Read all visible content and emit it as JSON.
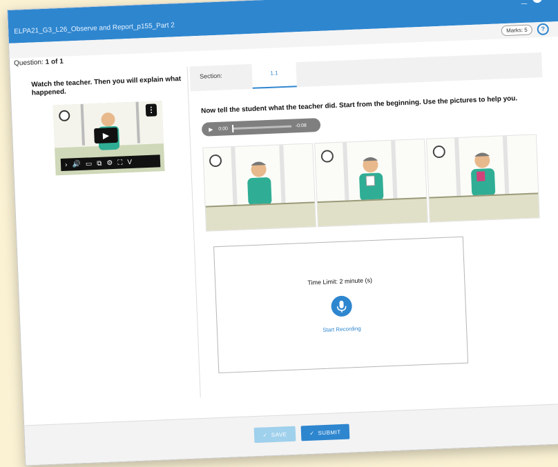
{
  "window": {
    "title": "ELPA21_G3_L26_Observe and Report_p155_Part 2",
    "minimize_symbol": "_",
    "close_symbol": "✕"
  },
  "marks": {
    "label": "Marks: 5"
  },
  "help": {
    "symbol": "?"
  },
  "question_counter": {
    "prefix": "Question:",
    "value": "1 of 1"
  },
  "left_panel": {
    "prompt": "Watch the teacher. Then you will explain what happened.",
    "video": {
      "play_symbol": "▶",
      "kebab_symbol": "⋮",
      "controls": [
        "›",
        "🔊",
        "▭",
        "⧉",
        "⚙",
        "⛶",
        "V"
      ]
    }
  },
  "section": {
    "label": "Section:",
    "tab": "1.1"
  },
  "instruction": "Now tell the student what the teacher did. Start from the beginning. Use the pictures to help you.",
  "audio": {
    "play_symbol": "▶",
    "current": "0:00",
    "remaining": "-0:08"
  },
  "pictures": [
    "picture-1",
    "picture-2",
    "picture-3"
  ],
  "recorder": {
    "time_limit": "Time Limit: 2 minute (s)",
    "start_label": "Start Recording"
  },
  "footer": {
    "save_label": "SAVE",
    "submit_label": "SUBMIT",
    "check_symbol": "✓"
  },
  "colors": {
    "accent": "#2e86cf",
    "background": "#fbf2d4",
    "save_disabled": "#9fd0ec"
  }
}
